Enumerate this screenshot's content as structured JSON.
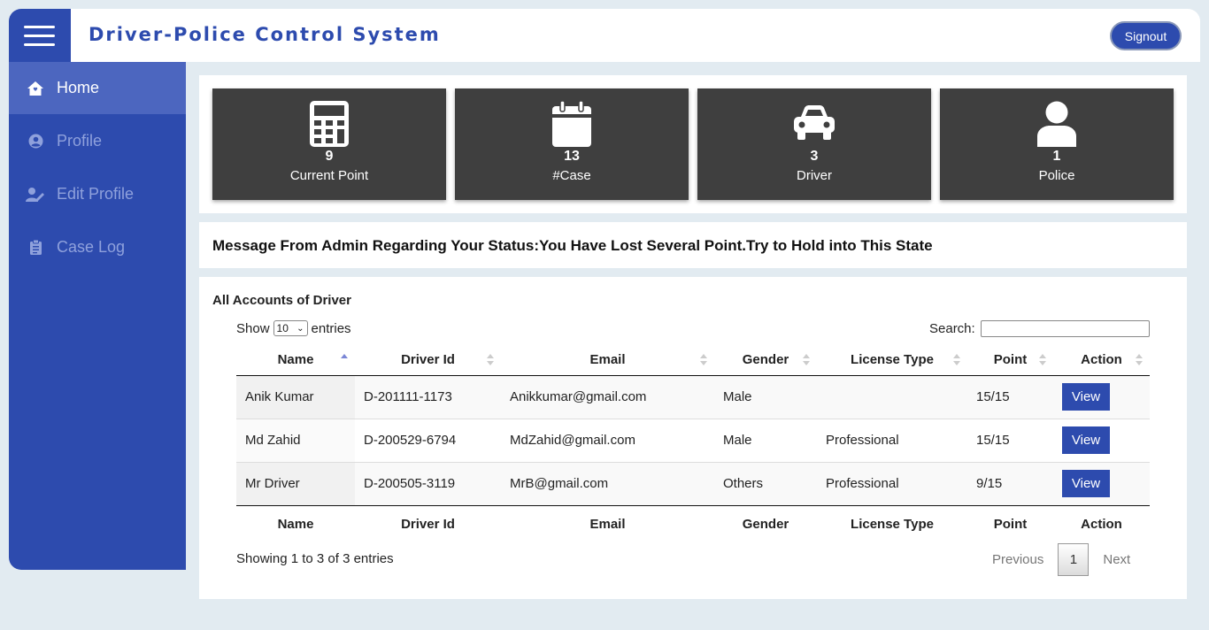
{
  "app": {
    "title": "Driver-Police Control System",
    "signout_label": "Signout"
  },
  "sidebar": {
    "items": [
      {
        "label": "Home",
        "icon": "home-icon",
        "active": true
      },
      {
        "label": "Profile",
        "icon": "user-circle-icon",
        "active": false
      },
      {
        "label": "Edit Profile",
        "icon": "user-edit-icon",
        "active": false
      },
      {
        "label": "Case Log",
        "icon": "clipboard-icon",
        "active": false
      }
    ]
  },
  "stats": [
    {
      "value": "9",
      "label": "Current Point",
      "icon": "calculator-icon"
    },
    {
      "value": "13",
      "label": "#Case",
      "icon": "calendar-icon"
    },
    {
      "value": "3",
      "label": "Driver",
      "icon": "car-icon"
    },
    {
      "value": "1",
      "label": "Police",
      "icon": "user-icon"
    }
  ],
  "message": "Message From Admin Regarding Your Status:You Have Lost Several Point.Try to Hold into This State",
  "table": {
    "title": "All Accounts of Driver",
    "show_label": "Show",
    "page_size": "10",
    "entries_label": "entries",
    "search_label": "Search:",
    "columns": [
      "Name",
      "Driver Id",
      "Email",
      "Gender",
      "License Type",
      "Point",
      "Action"
    ],
    "rows": [
      {
        "name": "Anik Kumar",
        "driver_id": "D-201111-1173",
        "email": "Anikkumar@gmail.com",
        "gender": "Male",
        "license_type": "",
        "point": "15/15",
        "action": "View"
      },
      {
        "name": "Md Zahid",
        "driver_id": "D-200529-6794",
        "email": "MdZahid@gmail.com",
        "gender": "Male",
        "license_type": "Professional",
        "point": "15/15",
        "action": "View"
      },
      {
        "name": "Mr Driver",
        "driver_id": "D-200505-3119",
        "email": "MrB@gmail.com",
        "gender": "Others",
        "license_type": "Professional",
        "point": "9/15",
        "action": "View"
      }
    ],
    "info": "Showing 1 to 3 of 3 entries",
    "pagination": {
      "previous": "Previous",
      "current": "1",
      "next": "Next"
    }
  },
  "colors": {
    "primary": "#2d4bae",
    "card": "#3f3f3f",
    "background": "#e2ebf1"
  }
}
